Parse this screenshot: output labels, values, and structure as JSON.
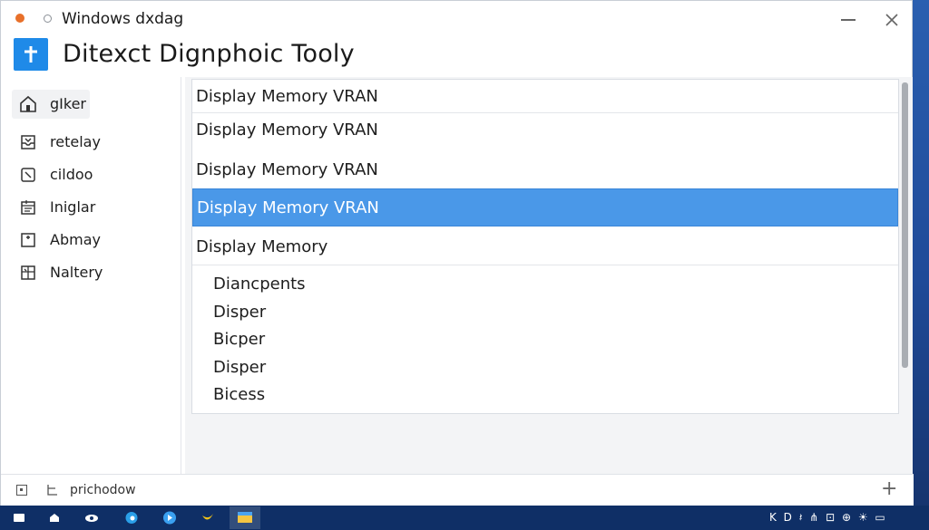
{
  "window": {
    "title": "Windows dxdag",
    "app_title": "Ditexct Dignphoic Tooly"
  },
  "sidebar": {
    "items": [
      {
        "label": "gIker",
        "icon": "home-icon"
      },
      {
        "label": "retelay",
        "icon": "inbox-icon"
      },
      {
        "label": "cildoo",
        "icon": "display-icon"
      },
      {
        "label": "Iniglar",
        "icon": "document-icon"
      },
      {
        "label": "Abmay",
        "icon": "image-icon"
      },
      {
        "label": "Naltery",
        "icon": "grid-icon"
      }
    ]
  },
  "list": {
    "rows": [
      {
        "label": "Display Memory VRAN"
      },
      {
        "label": "Display Memory VRAN"
      },
      {
        "label": "Display Memory VRAN"
      },
      {
        "label": "Display Memory VRAN",
        "selected": true
      },
      {
        "label": "Display Memory"
      }
    ],
    "subitems": [
      "Diancpents",
      "Disper",
      "Bicper",
      "Disper",
      "Bicess"
    ]
  },
  "statusbar": {
    "text": "prichodow"
  },
  "taskbar": {
    "icons": [
      "start-icon",
      "home-icon",
      "eye-icon",
      "edge-icon",
      "store-icon",
      "banana-icon",
      "explorer-icon"
    ],
    "tray_text": "K D 𝄽 ⋔ ⊡ ⊕ ☀ ▭"
  },
  "colors": {
    "accent": "#1f8ae8",
    "selection": "#4a98e8",
    "taskbar": "#0f2f66",
    "status_orange": "#e8702a"
  }
}
